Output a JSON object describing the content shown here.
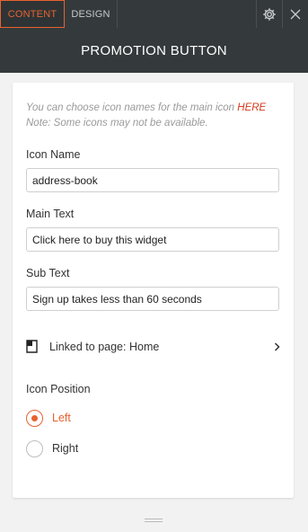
{
  "tabs": [
    {
      "label": "CONTENT",
      "active": true
    },
    {
      "label": "DESIGN",
      "active": false
    }
  ],
  "toolbar_icons": [
    "gear-icon",
    "close-icon"
  ],
  "header": {
    "title": "PROMOTION BUTTON"
  },
  "hint": {
    "line1": "You can choose icon names for the main icon",
    "link": "HERE",
    "line2": "Note: Some icons may not be available."
  },
  "fields": {
    "icon_name": {
      "label": "Icon Name",
      "value": "address-book"
    },
    "main_text": {
      "label": "Main Text",
      "value": "Click here to buy this widget"
    },
    "sub_text": {
      "label": "Sub Text",
      "value": "Sign up takes less than 60 seconds"
    }
  },
  "link": {
    "label": "Linked to page: Home"
  },
  "icon_position": {
    "label": "Icon Position",
    "options": [
      "Left",
      "Right"
    ],
    "selected": "Left"
  },
  "colors": {
    "accent": "#e8622f",
    "link": "#d63b1f",
    "header_bg": "#343a3c",
    "page_bg": "#f2f2f2"
  }
}
